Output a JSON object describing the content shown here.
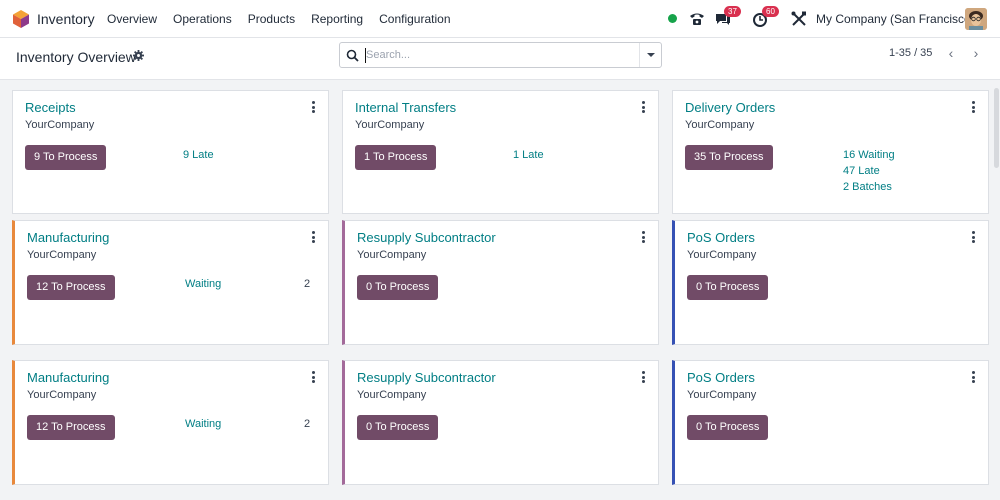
{
  "nav": {
    "app_name": "Inventory",
    "menu": [
      "Overview",
      "Operations",
      "Products",
      "Reporting",
      "Configuration"
    ],
    "messages_count": "37",
    "activities_count": "60",
    "company": "My Company (San Francisco)",
    "status_color": "#16a34a"
  },
  "control": {
    "title": "Inventory Overview",
    "search_placeholder": "Search...",
    "pager": "1-35 / 35"
  },
  "cards": [
    {
      "title": "Receipts",
      "company": "YourCompany",
      "button": "9 To Process",
      "links": [
        "9 Late"
      ]
    },
    {
      "title": "Internal Transfers",
      "company": "YourCompany",
      "button": "1 To Process",
      "links": [
        "1 Late"
      ]
    },
    {
      "title": "Delivery Orders",
      "company": "YourCompany",
      "button": "35 To Process",
      "links": [
        "16 Waiting",
        "47 Late",
        "2 Batches"
      ]
    },
    {
      "title": "Manufacturing",
      "company": "YourCompany",
      "button": "12 To Process",
      "links": [
        "Waiting"
      ],
      "count": "2"
    },
    {
      "title": "Resupply Subcontractor",
      "company": "YourCompany",
      "button": "0 To Process"
    },
    {
      "title": "PoS Orders",
      "company": "YourCompany",
      "button": "0 To Process"
    },
    {
      "title": "Manufacturing",
      "company": "YourCompany",
      "button": "12 To Process",
      "links": [
        "Waiting"
      ],
      "count": "2"
    },
    {
      "title": "Resupply Subcontractor",
      "company": "YourCompany",
      "button": "0 To Process"
    },
    {
      "title": "PoS Orders",
      "company": "YourCompany",
      "button": "0 To Process"
    }
  ],
  "colors": {
    "accent": "#714b67",
    "link": "#017e84",
    "manufacturing": "#e8893c",
    "subcontractor": "#a36a9a",
    "pos": "#3651b4"
  }
}
